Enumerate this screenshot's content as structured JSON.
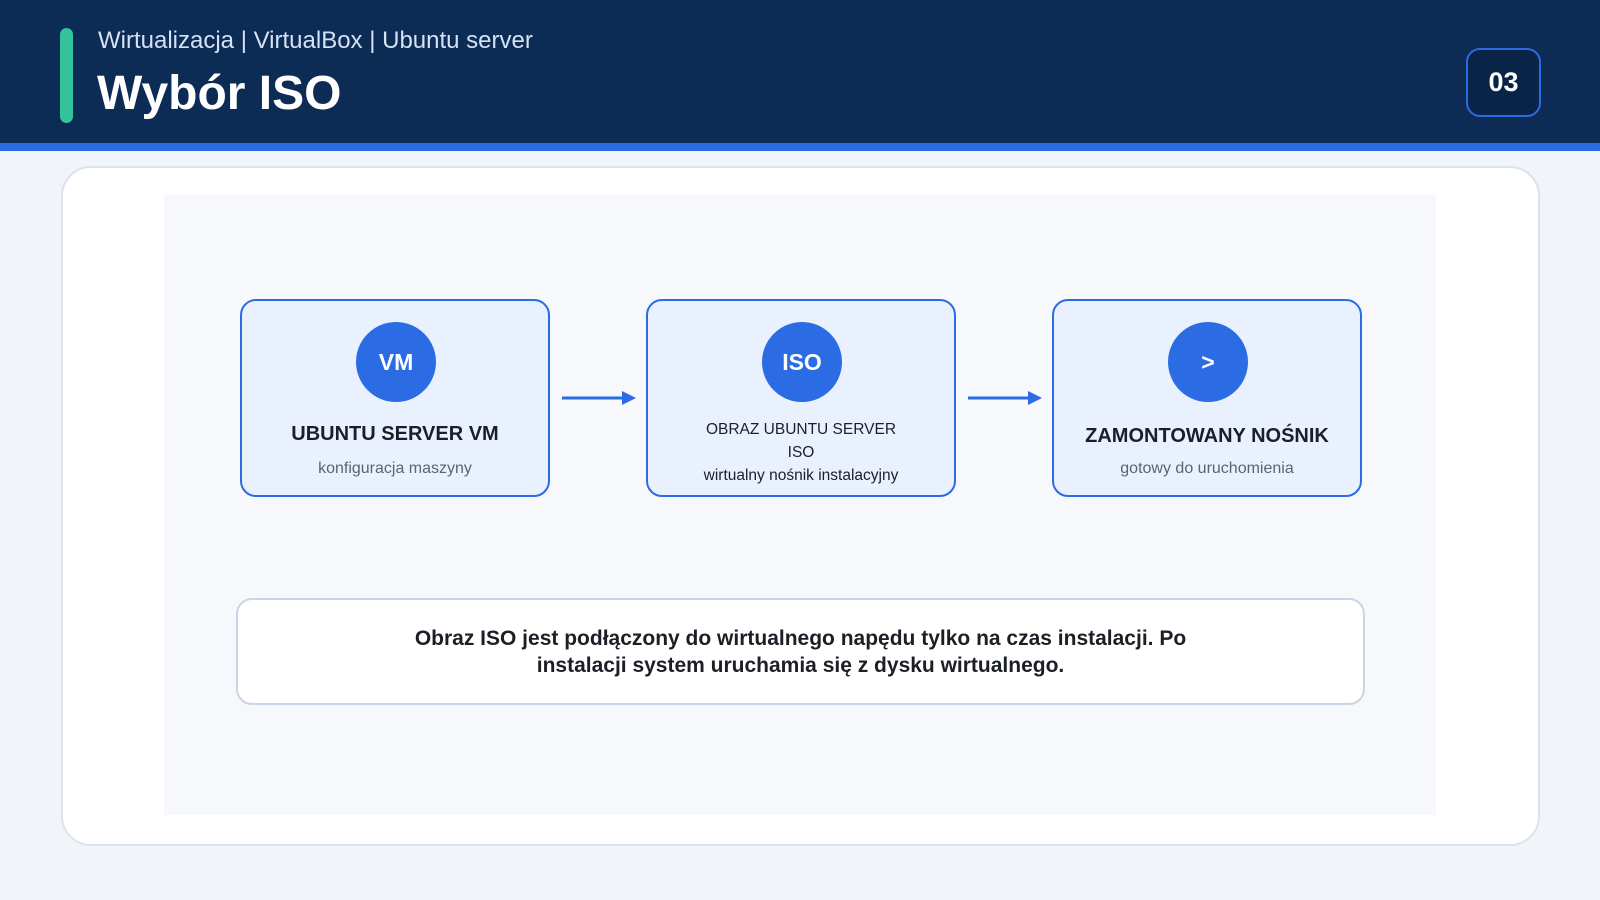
{
  "header": {
    "breadcrumb": "Wirtualizacja | VirtualBox | Ubuntu server",
    "title": "Wybór ISO",
    "page_number": "03"
  },
  "diagram": {
    "nodes": [
      {
        "icon_text": "VM",
        "title": "UBUNTU SERVER VM",
        "subtitle": "konfiguracja maszyny"
      },
      {
        "icon_text": "ISO",
        "lines": [
          "OBRAZ UBUNTU SERVER",
          "ISO",
          "wirtualny nośnik instalacyjny"
        ]
      },
      {
        "icon_text": ">",
        "title": "ZAMONTOWANY NOŚNIK",
        "subtitle": "gotowy do uruchomienia"
      }
    ],
    "edges": [
      {
        "from": "UBUNTU SERVER VM",
        "to": "OBRAZ UBUNTU SERVER ISO"
      },
      {
        "from": "OBRAZ UBUNTU SERVER ISO",
        "to": "ZAMONTOWANY NOŚNIK"
      }
    ],
    "note_lines": [
      "Obraz ISO jest podłączony do wirtualnego napędu tylko na czas instalacji. Po",
      "instalacji system uruchamia się z dysku wirtualnego."
    ]
  },
  "colors": {
    "header_bg": "#0c2b55",
    "accent_green": "#35c29a",
    "primary_blue": "#2b6be3",
    "node_bg": "#eaf1fe"
  }
}
